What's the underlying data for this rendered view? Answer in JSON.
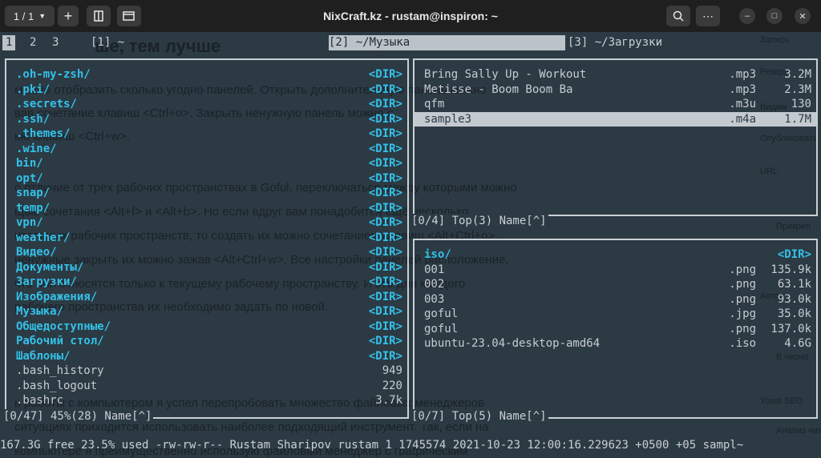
{
  "window": {
    "title": "NixCraft.kz - rustam@inspiron: ~",
    "tab_counter": "1 / 1",
    "add_label": "+"
  },
  "tabs": [
    {
      "label": "1",
      "active": true
    },
    {
      "label": "2",
      "active": false
    },
    {
      "label": "3",
      "active": false
    },
    {
      "label": "[1] ~",
      "active": false
    },
    {
      "label": "[2] ~/Музыка",
      "active": true
    },
    {
      "label": "[3] ~/Загрузки",
      "active": false
    }
  ],
  "left_panel": {
    "status": "[0/47] 45%(28) Name[^]",
    "items": [
      {
        "name": ".oh-my-zsh/",
        "ext": "",
        "size": "<DIR>",
        "type": "dir"
      },
      {
        "name": ".pki/",
        "ext": "",
        "size": "<DIR>",
        "type": "dir"
      },
      {
        "name": ".secrets/",
        "ext": "",
        "size": "<DIR>",
        "type": "dir"
      },
      {
        "name": ".ssh/",
        "ext": "",
        "size": "<DIR>",
        "type": "dir"
      },
      {
        "name": ".themes/",
        "ext": "",
        "size": "<DIR>",
        "type": "dir"
      },
      {
        "name": ".wine/",
        "ext": "",
        "size": "<DIR>",
        "type": "dir"
      },
      {
        "name": "bin/",
        "ext": "",
        "size": "<DIR>",
        "type": "dir"
      },
      {
        "name": "opt/",
        "ext": "",
        "size": "<DIR>",
        "type": "dir"
      },
      {
        "name": "snap/",
        "ext": "",
        "size": "<DIR>",
        "type": "dir"
      },
      {
        "name": "temp/",
        "ext": "",
        "size": "<DIR>",
        "type": "dir"
      },
      {
        "name": "vpn/",
        "ext": "",
        "size": "<DIR>",
        "type": "dir"
      },
      {
        "name": "weather/",
        "ext": "",
        "size": "<DIR>",
        "type": "dir"
      },
      {
        "name": "Видео/",
        "ext": "",
        "size": "<DIR>",
        "type": "dir"
      },
      {
        "name": "Документы/",
        "ext": "",
        "size": "<DIR>",
        "type": "dir"
      },
      {
        "name": "Загрузки/",
        "ext": "",
        "size": "<DIR>",
        "type": "dir"
      },
      {
        "name": "Изображения/",
        "ext": "",
        "size": "<DIR>",
        "type": "dir"
      },
      {
        "name": "Музыка/",
        "ext": "",
        "size": "<DIR>",
        "type": "dir"
      },
      {
        "name": "Общедоступные/",
        "ext": "",
        "size": "<DIR>",
        "type": "dir"
      },
      {
        "name": "Рабочий стол/",
        "ext": "",
        "size": "<DIR>",
        "type": "dir"
      },
      {
        "name": "Шаблоны/",
        "ext": "",
        "size": "<DIR>",
        "type": "dir"
      },
      {
        "name": ".bash_history",
        "ext": "",
        "size": "949",
        "type": "file"
      },
      {
        "name": ".bash_logout",
        "ext": "",
        "size": "220",
        "type": "file"
      },
      {
        "name": ".bashrc",
        "ext": "",
        "size": "3.7k",
        "type": "file"
      }
    ]
  },
  "right_top_panel": {
    "status": "[0/4] Top(3) Name[^]",
    "items": [
      {
        "name": "Bring Sally Up - Workout",
        "ext": ".mp3",
        "size": "3.2M",
        "type": "file",
        "selected": false
      },
      {
        "name": "Metisse - Boom Boom Ba",
        "ext": ".mp3",
        "size": "2.3M",
        "type": "file",
        "selected": false
      },
      {
        "name": "qfm",
        "ext": ".m3u",
        "size": "130",
        "type": "file",
        "selected": false
      },
      {
        "name": "sample3",
        "ext": ".m4a",
        "size": "1.7M",
        "type": "file",
        "selected": true
      }
    ]
  },
  "right_bottom_panel": {
    "status": "[0/7] Top(5) Name[^]",
    "items": [
      {
        "name": "iso/",
        "ext": "",
        "size": "<DIR>",
        "type": "dir"
      },
      {
        "name": "001",
        "ext": ".png",
        "size": "135.9k",
        "type": "file"
      },
      {
        "name": "002",
        "ext": ".png",
        "size": "63.1k",
        "type": "file"
      },
      {
        "name": "003",
        "ext": ".png",
        "size": "93.0k",
        "type": "file"
      },
      {
        "name": "goful",
        "ext": ".jpg",
        "size": "35.0k",
        "type": "file"
      },
      {
        "name": "goful",
        "ext": ".png",
        "size": "137.0k",
        "type": "file"
      },
      {
        "name": "ubuntu-23.04-desktop-amd64",
        "ext": ".iso",
        "size": "4.6G",
        "type": "file"
      }
    ]
  },
  "statusline": "167.3G free 23.5% used -rw-rw-r-- Rustam Sharipov rustam 1 1745574 2021-10-23 12:00:16.229623 +0500 +05 sampl~",
  "background_page": {
    "heading": "ше, тем лучше",
    "lines": [
      "можно отобразить сколько угодно панелей. Открыть дополнительную панель можно",
      "вав сочетание клавиш <Ctrl+o>. Закрыть ненужную панель можно с",
      "ью клавиш <Ctrl+w>.",
      "о отличие от трёх рабочих пространствах в Goful, переключаться между которыми можно",
      "щью сочетания <Alt+f> и <Alt+b>. Но если вдруг вам понадобится ещё несколько",
      "ительных рабочих пространств, то создать их можно сочетанием клавиш <Alt+Ctrl+o>.",
      "ненужные закрыть их можно зажав <Alt+Ctrl+w>. Все настройки панелей расположение,",
      "что они относятся только к текущему рабочему пространству. И это для каждого",
      "рабочего пространства их необходимо задать по новой.",
      "ь работы с компьютером я успел перепробовать множество файловых менеджеров",
      "ситуациях приходится использовать наиболее подходящий инструмент. Так, если на",
      "компьютере я преимущественно использую файловый менеджер с графическим"
    ],
    "sidebar": [
      "Запись",
      "Резерв",
      "Видим",
      "Опубликовать",
      "URL",
      "Прикреп",
      "Автор",
      "В черно",
      "Yoast SEO",
      "Анализ чит"
    ]
  }
}
